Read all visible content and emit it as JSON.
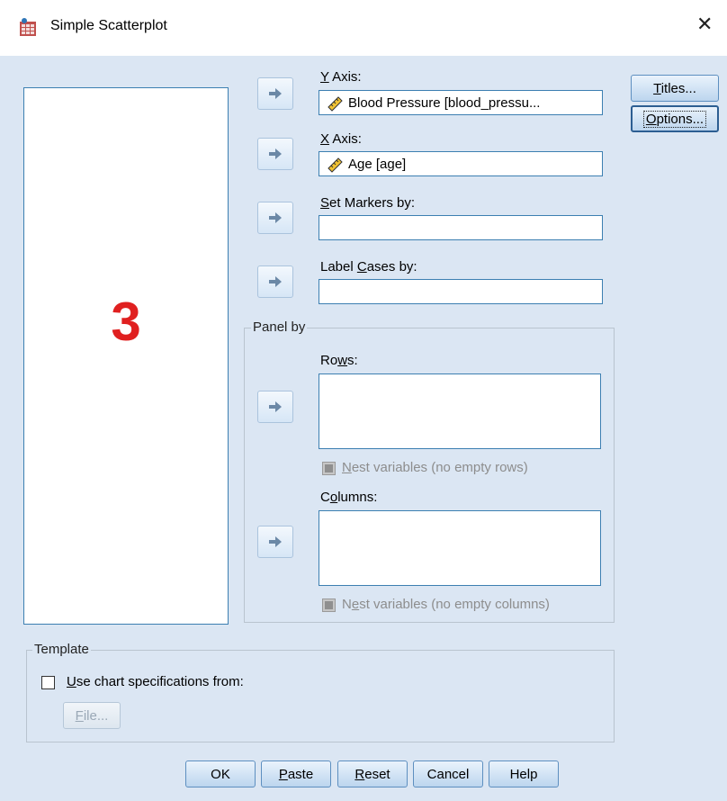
{
  "window": {
    "title": "Simple Scatterplot",
    "close_glyph": "✕",
    "icon": "scatterplot-app-icon"
  },
  "variable_list": {
    "overlay_number": "3"
  },
  "y_axis": {
    "label_key": "Y",
    "label_rest": " Axis:",
    "value": "Blood Pressure [blood_pressu...",
    "icon": "ruler-scale-icon"
  },
  "x_axis": {
    "label_key": "X",
    "label_rest": " Axis:",
    "value": "Age [age]",
    "icon": "ruler-scale-icon"
  },
  "set_markers": {
    "label_key": "S",
    "label_rest": "et Markers by:",
    "value": ""
  },
  "label_cases": {
    "label_pre": "Label ",
    "label_key": "C",
    "label_rest": "ases by:",
    "value": ""
  },
  "panel_by": {
    "title": "Panel by",
    "rows": {
      "label_pre": "Ro",
      "label_key": "w",
      "label_rest": "s:",
      "nest_key": "N",
      "nest_rest": "est variables (no empty rows)"
    },
    "columns": {
      "label_pre": "C",
      "label_key": "o",
      "label_rest": "lumns:",
      "nest_pre": "N",
      "nest_key": "e",
      "nest_rest": "st variables (no empty columns)"
    }
  },
  "template": {
    "title": "Template",
    "checkbox_key": "U",
    "checkbox_rest": "se chart specifications from:",
    "file_key": "F",
    "file_rest": "ile..."
  },
  "side_buttons": {
    "titles_key": "T",
    "titles_rest": "itles...",
    "options_key": "O",
    "options_rest": "ptions..."
  },
  "bottom_buttons": {
    "ok": "OK",
    "paste_key": "P",
    "paste_rest": "aste",
    "reset_key": "R",
    "reset_rest": "eset",
    "cancel": "Cancel",
    "help": "Help"
  },
  "colors": {
    "background": "#dbe6f3",
    "field_border": "#3c7fb1",
    "overlay_number": "#e02020"
  }
}
